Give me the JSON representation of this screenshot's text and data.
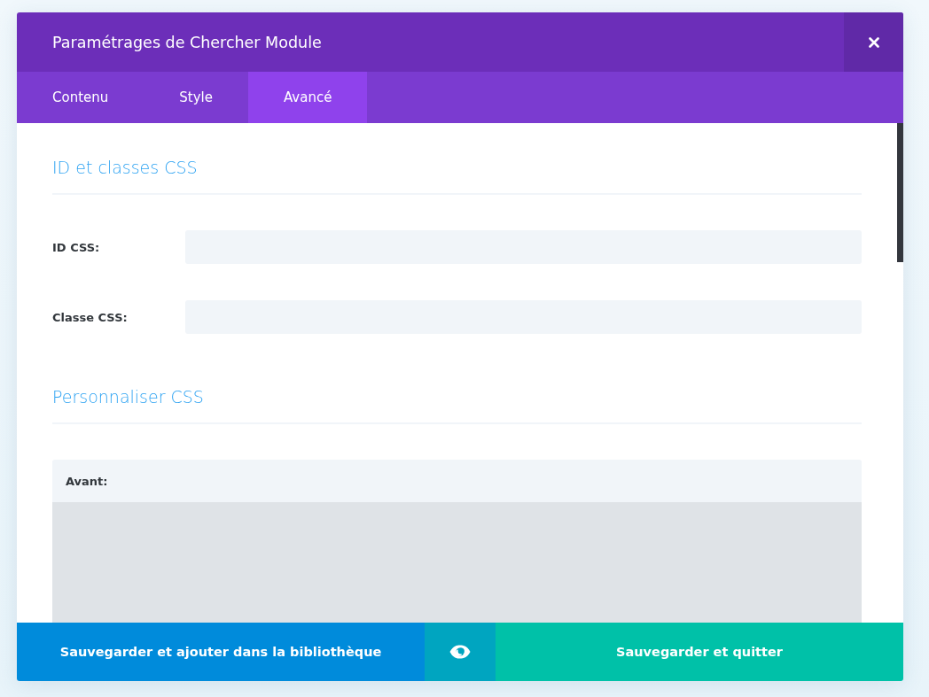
{
  "dialog": {
    "title": "Paramétrages de Chercher Module"
  },
  "tabs": [
    {
      "label": "Contenu",
      "selected": false
    },
    {
      "label": "Style",
      "selected": false
    },
    {
      "label": "Avancé",
      "selected": true
    }
  ],
  "sections": [
    {
      "kind": "fields",
      "title": "ID et classes CSS",
      "fields": [
        {
          "label": "ID CSS:"
        },
        {
          "label": "Classe CSS:"
        }
      ]
    },
    {
      "kind": "css",
      "title": "Personnaliser CSS",
      "editors": [
        {
          "label": "Avant:"
        }
      ]
    }
  ],
  "footer": {
    "buttons": [
      {
        "kind": "library",
        "label": "Sauvegarder et ajouter dans la bibliothèque"
      },
      {
        "kind": "preview"
      },
      {
        "kind": "save",
        "label": "Sauvegarder et quitter"
      }
    ]
  }
}
